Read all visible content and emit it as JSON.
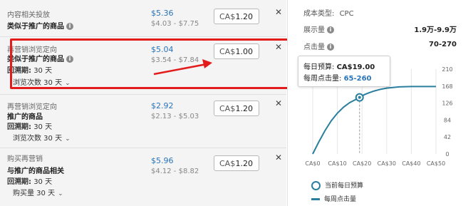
{
  "rows": [
    {
      "title": "内容相关投放",
      "bold": "类似于推广的商品",
      "price": "$5.36",
      "range": "$4.03 - $7.75",
      "currency": "CA$",
      "bid": "1.20"
    },
    {
      "title": "再营销浏览定向",
      "bold": "类似于推广的商品",
      "lookback_label": "回溯期:",
      "lookback_value": "30 天",
      "dropdown": "浏览次数 30 天",
      "price": "$5.04",
      "range": "$3.54 - $7.84",
      "currency": "CA$",
      "bid": "1.00"
    },
    {
      "title": "再营销浏览定向",
      "bold": "推广的商品",
      "lookback_label": "回溯期:",
      "lookback_value": "30 天",
      "dropdown": "浏览次数 30 天",
      "price": "$2.92",
      "range": "$2.13 - $5.03",
      "currency": "CA$",
      "bid": "1.20"
    },
    {
      "title": "购买再营销",
      "bold": "与推广的商品相关",
      "lookback_label": "回溯期:",
      "lookback_value": "30 天",
      "dropdown": "购买量 30 天",
      "price": "$5.96",
      "range": "$4.12 - $8.82",
      "currency": "CA$",
      "bid": "1.20"
    }
  ],
  "right": {
    "cost_type_label": "成本类型:",
    "cost_type_value": "CPC",
    "impressions_label": "展示量",
    "impressions_value": "1.9万-9.9万",
    "clicks_label": "点击量",
    "clicks_value": "70-270",
    "tooltip_budget_label": "每日预算:",
    "tooltip_budget_value": "CA$19.00",
    "tooltip_clicks_label": "每周点击量:",
    "tooltip_clicks_value": "65-260",
    "legend_current": "当前每日预算",
    "legend_weekly": "每周点击量"
  },
  "chart_data": {
    "type": "line",
    "x_ticks": [
      "CA$0",
      "CA$10",
      "CA$20",
      "CA$30",
      "CA$40",
      "CA$50"
    ],
    "y_ticks": [
      "0",
      "42",
      "84",
      "126",
      "168",
      "210"
    ],
    "xlim": [
      0,
      50
    ],
    "ylim": [
      0,
      210
    ],
    "series": [
      {
        "x": [
          0,
          2.5,
          5,
          7.5,
          10,
          12.5,
          15,
          17.5,
          19,
          21,
          23,
          25,
          27.5,
          30,
          35,
          40,
          45,
          50
        ],
        "y": [
          0,
          30,
          58,
          82,
          101,
          116,
          127,
          135,
          140,
          147,
          152,
          156,
          160,
          163,
          166,
          167,
          167,
          167
        ]
      }
    ],
    "highlight_point": {
      "x": 19,
      "y": 140
    },
    "color": "#2a7f9e",
    "grid": "vertical"
  }
}
